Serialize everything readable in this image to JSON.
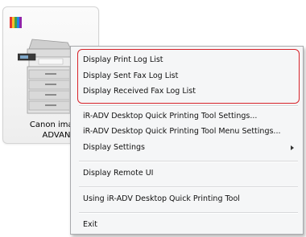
{
  "printer": {
    "name": "Canon image\nADVAN"
  },
  "menu": {
    "items": [
      {
        "label": "Display Print Log List"
      },
      {
        "label": "Display Sent Fax Log List"
      },
      {
        "label": "Display Received Fax Log List"
      },
      {
        "label": "iR-ADV Desktop Quick Printing Tool Settings..."
      },
      {
        "label": "iR-ADV Desktop Quick Printing Tool Menu Settings..."
      },
      {
        "label": "Display Settings"
      },
      {
        "label": "Display Remote UI"
      },
      {
        "label": "Using iR-ADV Desktop Quick Printing Tool"
      },
      {
        "label": "Exit"
      }
    ]
  },
  "colors": {
    "highlight": "#d8232a",
    "menu_bg": "#f5f6f7",
    "menu_border": "#a9aaad"
  }
}
